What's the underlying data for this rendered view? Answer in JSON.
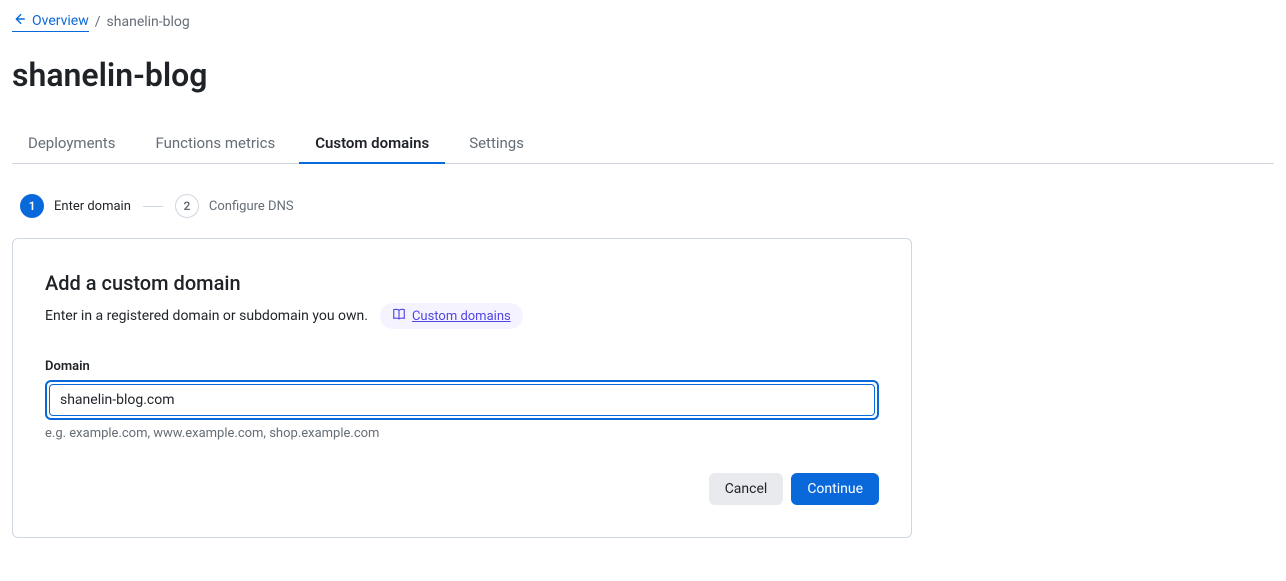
{
  "breadcrumb": {
    "back_label": "Overview",
    "separator": "/",
    "current": "shanelin-blog"
  },
  "page_title": "shanelin-blog",
  "tabs": [
    {
      "label": "Deployments",
      "active": false
    },
    {
      "label": "Functions metrics",
      "active": false
    },
    {
      "label": "Custom domains",
      "active": true
    },
    {
      "label": "Settings",
      "active": false
    }
  ],
  "steps": [
    {
      "num": "1",
      "label": "Enter domain",
      "active": true
    },
    {
      "num": "2",
      "label": "Configure DNS",
      "active": false
    }
  ],
  "card": {
    "title": "Add a custom domain",
    "subtitle": "Enter in a registered domain or subdomain you own.",
    "help_link": "Custom domains",
    "field_label": "Domain",
    "field_value": "shanelin-blog.com",
    "help_text": "e.g. example.com, www.example.com, shop.example.com",
    "cancel": "Cancel",
    "continue": "Continue"
  }
}
